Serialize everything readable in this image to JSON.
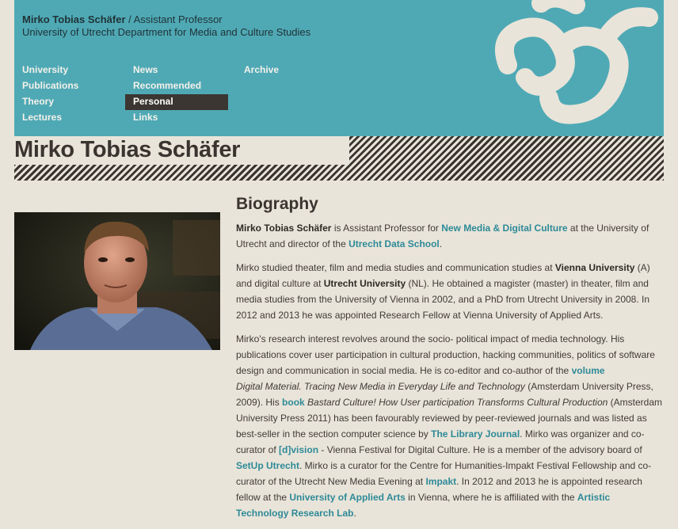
{
  "header": {
    "name": "Mirko Tobias Schäfer",
    "slash": " / ",
    "role": "Assistant Professor",
    "dept": "University of Utrecht Department for Media and Culture Studies"
  },
  "nav": {
    "col1": [
      "University",
      "Publications",
      "Theory",
      "Lectures"
    ],
    "col2": [
      "News",
      "Recommended",
      "Personal",
      "Links"
    ],
    "col3": [
      "Archive"
    ],
    "active": "Personal"
  },
  "colors": {
    "header_bg": "#4fa9b5",
    "page_bg": "#e9e4d9",
    "link": "#2e8a98",
    "active_nav": "#3b3631"
  },
  "page_title": "Mirko Tobias Schäfer",
  "bio": {
    "heading": "Biography",
    "p1": {
      "name": "Mirko Tobias Schäfer",
      "t1": " is Assistant Professor for ",
      "l1": "New Media & Digital Culture",
      "t2": " at the University of Utrecht and director of the ",
      "l2": "Utrecht Data School",
      "t3": "."
    },
    "p2": {
      "t1": "Mirko studied theater, film and media studies and communication studies at ",
      "b1": "Vienna University",
      "t2": " (A) and digital culture at ",
      "b2": "Utrecht University",
      "t3": " (NL). He obtained a magister (master) in theater, film and media studies from the University of Vienna in 2002, and a PhD from Utrecht University in 2008. In 2012 and 2013 he was appointed Research Fellow at Vienna University of Applied Arts."
    },
    "p3": {
      "t1": "Mirko's research interest revolves around the socio- political impact of media technology. His publications cover user participation in cultural production, hacking communities, politics of software design and communication in social media. He is co-editor and co-author of the ",
      "l1": "volume",
      "i1": "Digital Material. Tracing New Media in Everyday Life and Technology",
      "t2": " (Amsterdam University Press, 2009). His ",
      "l2": "book",
      "i2": "Bastard Culture! How User participation Transforms Cultural Production",
      "t3": " (Amsterdam University Press 2011) has been favourably reviewed by peer-reviewed journals and was listed as best-seller in the section computer science by ",
      "l3": "The Library Journal",
      "t4": ". Mirko was organizer and co-curator of ",
      "l4": "[d]vision",
      "t5": " - Vienna Festival for Digital Culture.  He is a member of the advisory board of ",
      "l5": "SetUp Utrecht",
      "t6": ". Mirko is a curator for the Centre for Humanities-Impakt Festival Fellowship and co-curator of the Utrecht New Media Evening at ",
      "l6": "Impakt",
      "t7": ". In 2012 and 2013 he is appointed research fellow at the ",
      "l7": "University of Applied Arts",
      "t8": " in Vienna, where he is affiliated with the ",
      "l8": "Artistic Technology Research Lab",
      "t9": "."
    }
  }
}
